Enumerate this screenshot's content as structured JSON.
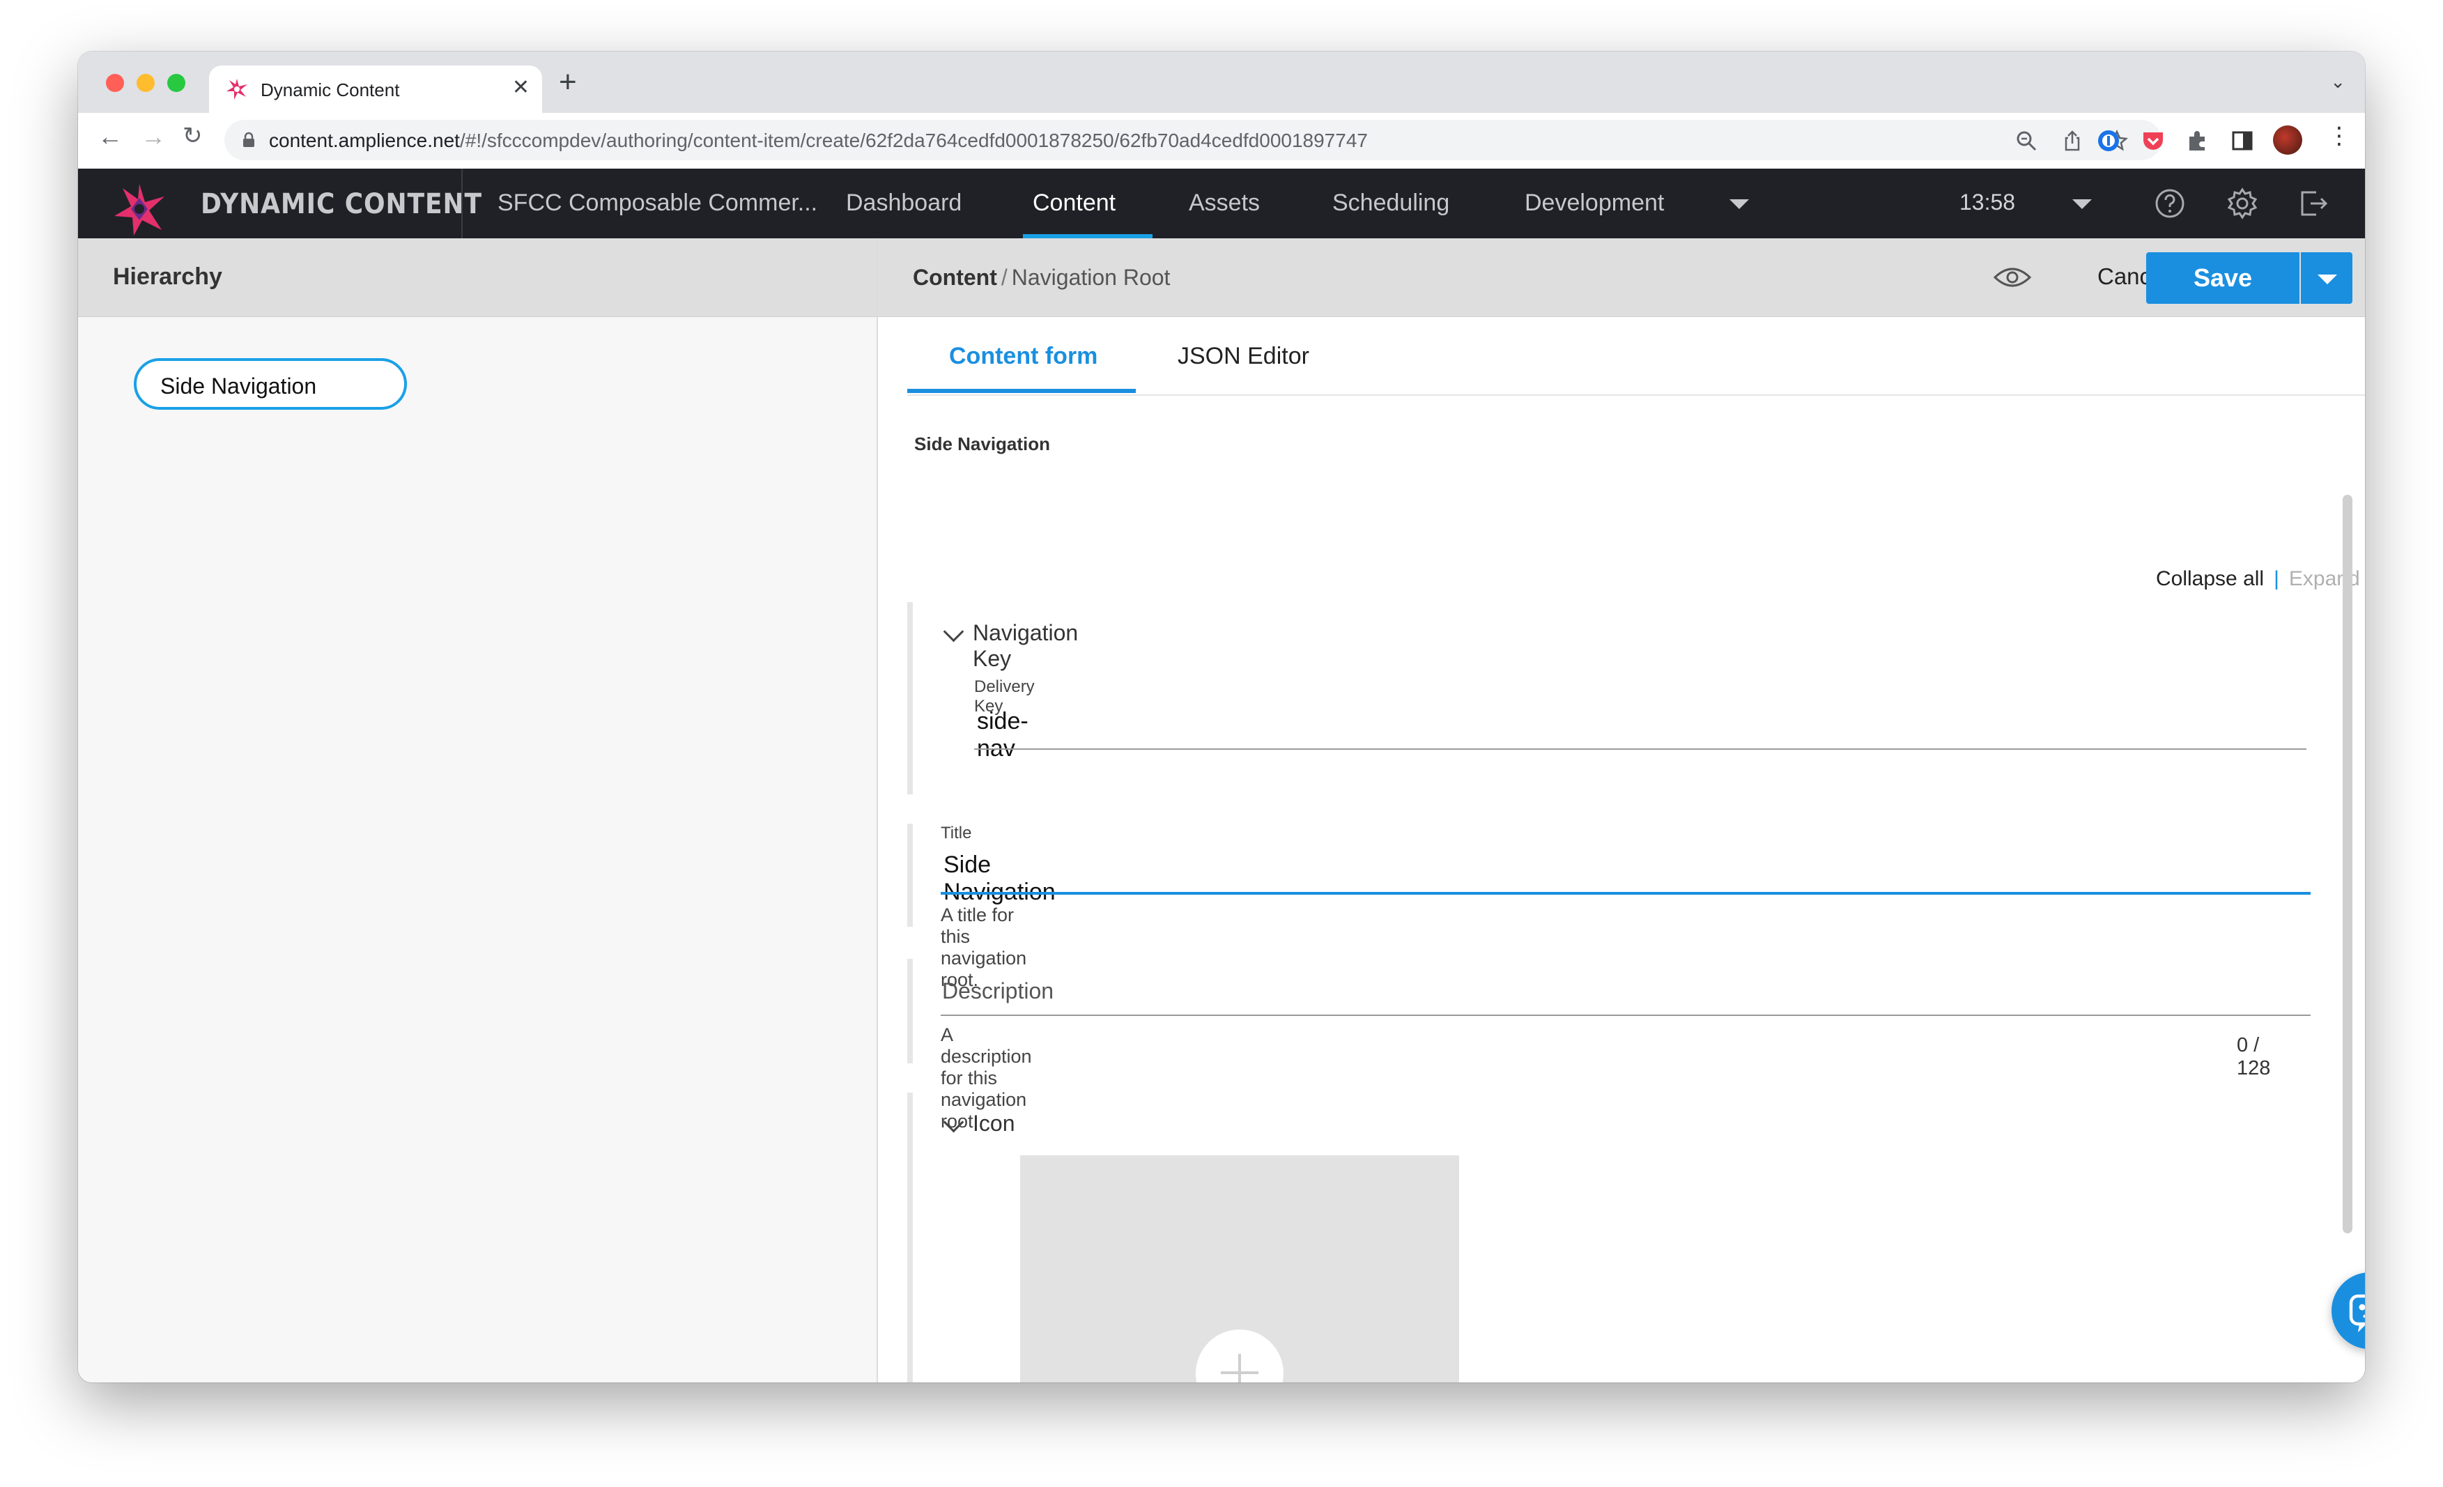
{
  "browser": {
    "tab_title": "Dynamic Content",
    "url_host": "content.amplience.net",
    "url_path": "/#!/sfcccompdev/authoring/content-item/create/62f2da764cedfd0001878250/62fb70ad4cedfd0001897747"
  },
  "app": {
    "brand": "DYNAMIC CONTENT",
    "nav": {
      "hub": "SFCC Composable Commer...",
      "dashboard": "Dashboard",
      "content": "Content",
      "assets": "Assets",
      "scheduling": "Scheduling",
      "development": "Development"
    },
    "time": "13:58"
  },
  "left_panel": {
    "title": "Hierarchy",
    "node": "Side Navigation"
  },
  "editor": {
    "breadcrumb_root": "Content",
    "breadcrumb_sep": "/",
    "breadcrumb_leaf": "Navigation Root",
    "cancel": "Cancel",
    "save": "Save",
    "tabs": {
      "form": "Content form",
      "json": "JSON Editor"
    },
    "section_title": "Side Navigation",
    "collapse_all": "Collapse all",
    "separator": "|",
    "expand_all": "Expand all",
    "navigation_key": {
      "label": "Navigation Key",
      "delivery_key_label": "Delivery Key",
      "delivery_key_value": "side-nav"
    },
    "title_field": {
      "label": "Title",
      "value": "Side Navigation",
      "helper": "A title for this navigation root."
    },
    "description_field": {
      "placeholder": "Description",
      "helper": "A description for this navigation root.",
      "counter": "0 / 128"
    },
    "icon_group": {
      "label": "Icon"
    }
  },
  "colors": {
    "accent": "#1a8fe0",
    "appbar": "#1f2127"
  }
}
